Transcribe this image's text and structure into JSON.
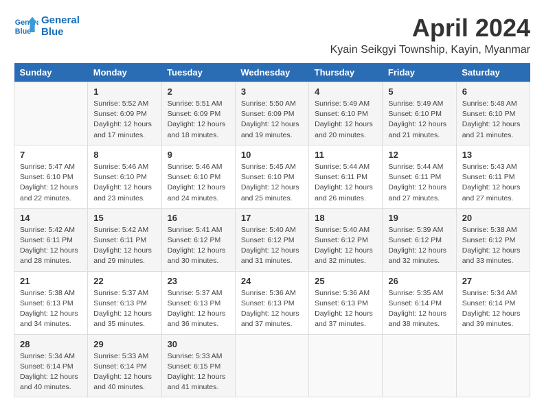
{
  "logo": {
    "line1": "General",
    "line2": "Blue"
  },
  "title": "April 2024",
  "subtitle": "Kyain Seikgyi Township, Kayin, Myanmar",
  "headers": [
    "Sunday",
    "Monday",
    "Tuesday",
    "Wednesday",
    "Thursday",
    "Friday",
    "Saturday"
  ],
  "weeks": [
    [
      {
        "day": "",
        "info": ""
      },
      {
        "day": "1",
        "info": "Sunrise: 5:52 AM\nSunset: 6:09 PM\nDaylight: 12 hours\nand 17 minutes."
      },
      {
        "day": "2",
        "info": "Sunrise: 5:51 AM\nSunset: 6:09 PM\nDaylight: 12 hours\nand 18 minutes."
      },
      {
        "day": "3",
        "info": "Sunrise: 5:50 AM\nSunset: 6:09 PM\nDaylight: 12 hours\nand 19 minutes."
      },
      {
        "day": "4",
        "info": "Sunrise: 5:49 AM\nSunset: 6:10 PM\nDaylight: 12 hours\nand 20 minutes."
      },
      {
        "day": "5",
        "info": "Sunrise: 5:49 AM\nSunset: 6:10 PM\nDaylight: 12 hours\nand 21 minutes."
      },
      {
        "day": "6",
        "info": "Sunrise: 5:48 AM\nSunset: 6:10 PM\nDaylight: 12 hours\nand 21 minutes."
      }
    ],
    [
      {
        "day": "7",
        "info": "Sunrise: 5:47 AM\nSunset: 6:10 PM\nDaylight: 12 hours\nand 22 minutes."
      },
      {
        "day": "8",
        "info": "Sunrise: 5:46 AM\nSunset: 6:10 PM\nDaylight: 12 hours\nand 23 minutes."
      },
      {
        "day": "9",
        "info": "Sunrise: 5:46 AM\nSunset: 6:10 PM\nDaylight: 12 hours\nand 24 minutes."
      },
      {
        "day": "10",
        "info": "Sunrise: 5:45 AM\nSunset: 6:10 PM\nDaylight: 12 hours\nand 25 minutes."
      },
      {
        "day": "11",
        "info": "Sunrise: 5:44 AM\nSunset: 6:11 PM\nDaylight: 12 hours\nand 26 minutes."
      },
      {
        "day": "12",
        "info": "Sunrise: 5:44 AM\nSunset: 6:11 PM\nDaylight: 12 hours\nand 27 minutes."
      },
      {
        "day": "13",
        "info": "Sunrise: 5:43 AM\nSunset: 6:11 PM\nDaylight: 12 hours\nand 27 minutes."
      }
    ],
    [
      {
        "day": "14",
        "info": "Sunrise: 5:42 AM\nSunset: 6:11 PM\nDaylight: 12 hours\nand 28 minutes."
      },
      {
        "day": "15",
        "info": "Sunrise: 5:42 AM\nSunset: 6:11 PM\nDaylight: 12 hours\nand 29 minutes."
      },
      {
        "day": "16",
        "info": "Sunrise: 5:41 AM\nSunset: 6:12 PM\nDaylight: 12 hours\nand 30 minutes."
      },
      {
        "day": "17",
        "info": "Sunrise: 5:40 AM\nSunset: 6:12 PM\nDaylight: 12 hours\nand 31 minutes."
      },
      {
        "day": "18",
        "info": "Sunrise: 5:40 AM\nSunset: 6:12 PM\nDaylight: 12 hours\nand 32 minutes."
      },
      {
        "day": "19",
        "info": "Sunrise: 5:39 AM\nSunset: 6:12 PM\nDaylight: 12 hours\nand 32 minutes."
      },
      {
        "day": "20",
        "info": "Sunrise: 5:38 AM\nSunset: 6:12 PM\nDaylight: 12 hours\nand 33 minutes."
      }
    ],
    [
      {
        "day": "21",
        "info": "Sunrise: 5:38 AM\nSunset: 6:13 PM\nDaylight: 12 hours\nand 34 minutes."
      },
      {
        "day": "22",
        "info": "Sunrise: 5:37 AM\nSunset: 6:13 PM\nDaylight: 12 hours\nand 35 minutes."
      },
      {
        "day": "23",
        "info": "Sunrise: 5:37 AM\nSunset: 6:13 PM\nDaylight: 12 hours\nand 36 minutes."
      },
      {
        "day": "24",
        "info": "Sunrise: 5:36 AM\nSunset: 6:13 PM\nDaylight: 12 hours\nand 37 minutes."
      },
      {
        "day": "25",
        "info": "Sunrise: 5:36 AM\nSunset: 6:13 PM\nDaylight: 12 hours\nand 37 minutes."
      },
      {
        "day": "26",
        "info": "Sunrise: 5:35 AM\nSunset: 6:14 PM\nDaylight: 12 hours\nand 38 minutes."
      },
      {
        "day": "27",
        "info": "Sunrise: 5:34 AM\nSunset: 6:14 PM\nDaylight: 12 hours\nand 39 minutes."
      }
    ],
    [
      {
        "day": "28",
        "info": "Sunrise: 5:34 AM\nSunset: 6:14 PM\nDaylight: 12 hours\nand 40 minutes."
      },
      {
        "day": "29",
        "info": "Sunrise: 5:33 AM\nSunset: 6:14 PM\nDaylight: 12 hours\nand 40 minutes."
      },
      {
        "day": "30",
        "info": "Sunrise: 5:33 AM\nSunset: 6:15 PM\nDaylight: 12 hours\nand 41 minutes."
      },
      {
        "day": "",
        "info": ""
      },
      {
        "day": "",
        "info": ""
      },
      {
        "day": "",
        "info": ""
      },
      {
        "day": "",
        "info": ""
      }
    ]
  ]
}
